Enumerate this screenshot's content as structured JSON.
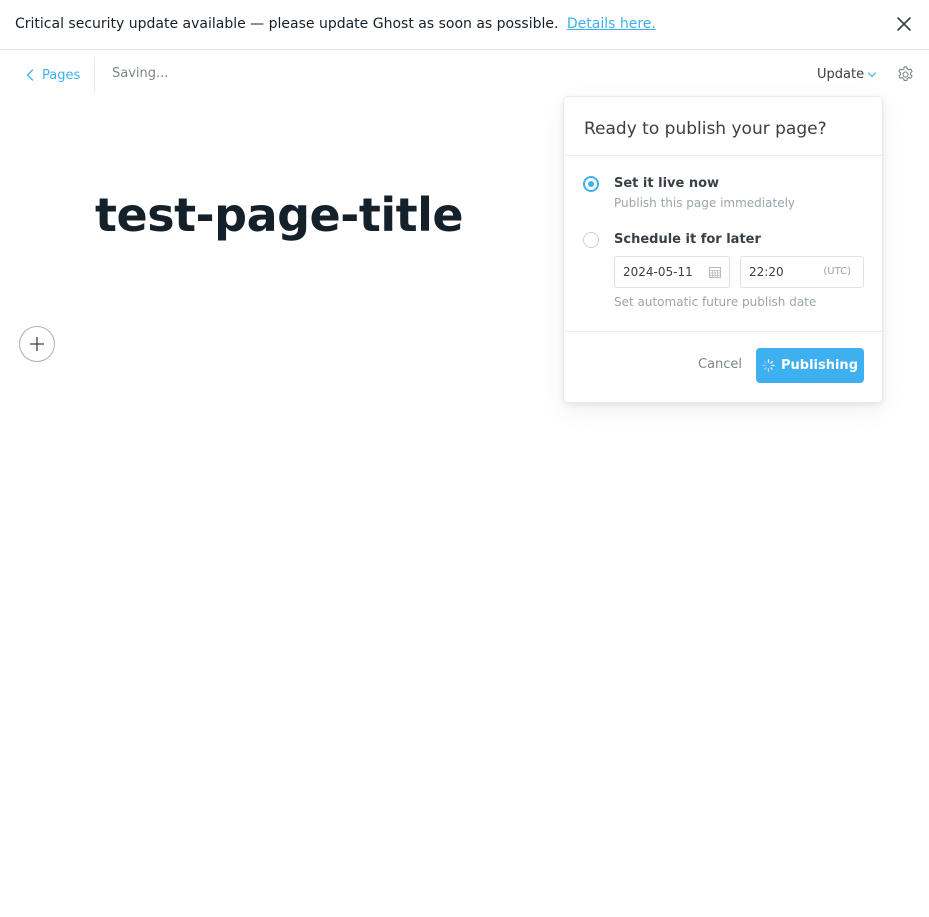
{
  "banner": {
    "message": "Critical security update available — please update Ghost as soon as possible.",
    "link_text": "Details here."
  },
  "nav": {
    "back_label": "Pages",
    "status": "Saving...",
    "update_label": "Update"
  },
  "editor": {
    "title": "test-page-title"
  },
  "publish_menu": {
    "heading": "Ready to publish your page?",
    "option_now": {
      "label": "Set it live now",
      "description": "Publish this page immediately",
      "selected": true
    },
    "option_later": {
      "label": "Schedule it for later",
      "selected": false
    },
    "date_value": "2024-05-11",
    "time_value": "22:20",
    "timezone": "(UTC)",
    "hint": "Set automatic future publish date",
    "cancel_label": "Cancel",
    "publish_label": "Publishing"
  },
  "colors": {
    "accent": "#3eb0ef",
    "text": "#15212a",
    "muted": "#9aa5ab"
  },
  "icons": [
    "close-icon",
    "chevron-left-icon",
    "chevron-down-icon",
    "gear-icon",
    "plus-icon",
    "calendar-icon",
    "spinner-icon"
  ]
}
